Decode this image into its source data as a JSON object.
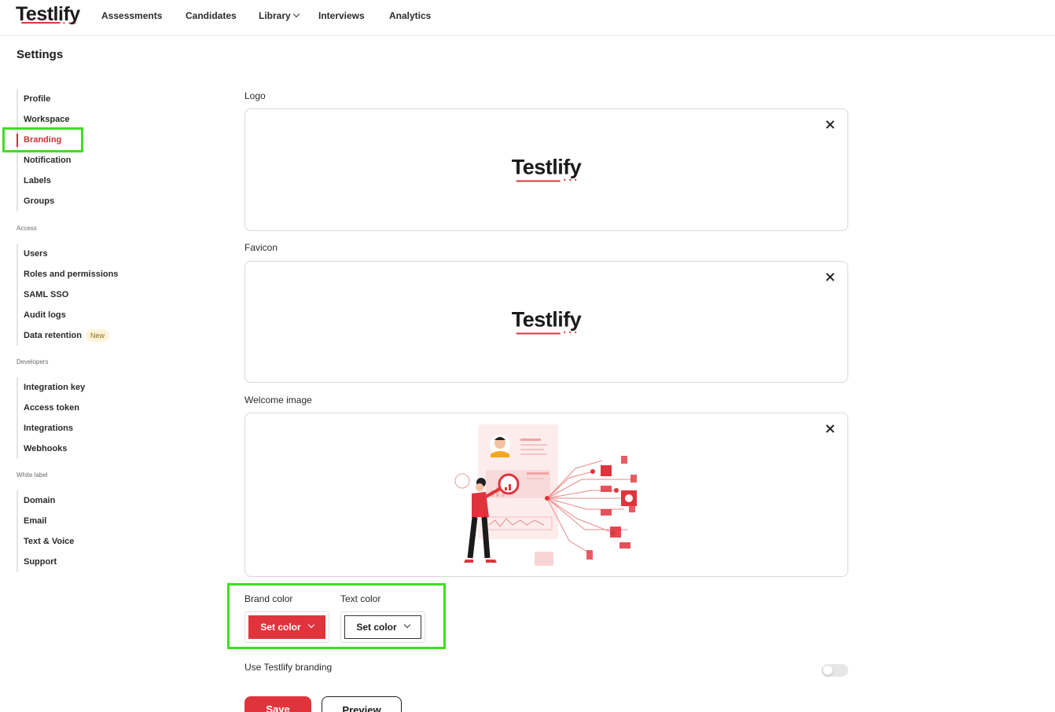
{
  "brand": {
    "name": "Testlify",
    "accent": "#e0343c"
  },
  "nav": {
    "assessments": "Assessments",
    "candidates": "Candidates",
    "library": "Library",
    "interviews": "Interviews",
    "analytics": "Analytics"
  },
  "page": {
    "title": "Settings"
  },
  "sidebar": {
    "general": [
      "Profile",
      "Workspace",
      "Branding",
      "Notification",
      "Labels",
      "Groups"
    ],
    "access_heading": "Access",
    "access": [
      "Users",
      "Roles and permissions",
      "SAML SSO",
      "Audit logs",
      "Data retention"
    ],
    "new_badge": "New",
    "developers_heading": "Developers",
    "developers": [
      "Integration key",
      "Access token",
      "Integrations",
      "Webhooks"
    ],
    "white_label_heading": "White label",
    "white_label": [
      "Domain",
      "Email",
      "Text & Voice",
      "Support"
    ],
    "active_item": "Branding"
  },
  "branding": {
    "logo_label": "Logo",
    "favicon_label": "Favicon",
    "welcome_label": "Welcome image",
    "brand_color_label": "Brand color",
    "text_color_label": "Text color",
    "set_color": "Set color",
    "brand_color_value": "#e0343c",
    "text_color_value": "#ffffff",
    "use_branding_label": "Use Testlify branding",
    "use_branding_enabled": false,
    "save": "Save",
    "preview": "Preview"
  }
}
